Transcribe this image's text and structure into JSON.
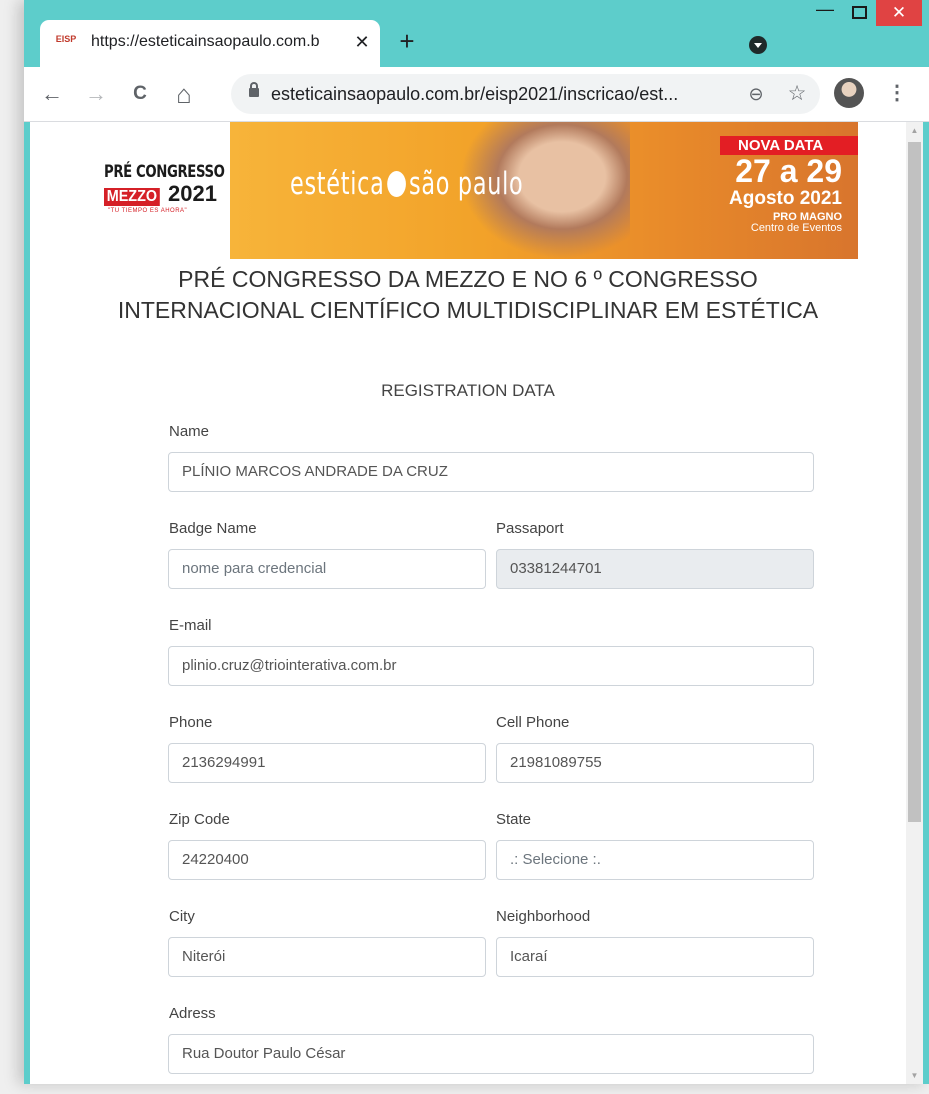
{
  "browser": {
    "tab_title": "https://esteticainsaopaulo.com.b",
    "tab_close": "✕",
    "new_tab": "+",
    "url": "esteticainsaopaulo.com.br/eisp2021/inscricao/est...",
    "win_min": "—",
    "win_close": "✕",
    "nav_back": "←",
    "nav_forward": "→",
    "nav_reload": "C",
    "nav_home": "⌂",
    "zoom_symbol": "⊖",
    "star_symbol": "☆",
    "menu_symbol": "⋮",
    "favicon_text": "EISP"
  },
  "banner": {
    "pre_congresso": "PRÉ CONGRESSO",
    "mezzo": "MEZZO",
    "year": "2021",
    "tagline": "\"TU TIEMPO ES AHORA\"",
    "brand_left": "estética",
    "brand_right": "são paulo",
    "nova_data": "NOVA DATA",
    "dates": "27 a 29",
    "month": "Agosto 2021",
    "venue": "PRO MAGNO",
    "venue_sub": "Centro de Eventos"
  },
  "page": {
    "title": "PRÉ CONGRESSO DA MEZZO E NO 6 º CONGRESSO INTERNACIONAL CIENTÍFICO MULTIDISCIPLINAR EM ESTÉTICA",
    "section": "REGISTRATION DATA"
  },
  "form": {
    "name": {
      "label": "Name",
      "value": "PLÍNIO MARCOS ANDRADE DA CRUZ"
    },
    "badge_name": {
      "label": "Badge Name",
      "placeholder": "nome para credencial"
    },
    "passport": {
      "label": "Passaport",
      "value": "03381244701"
    },
    "email": {
      "label": "E-mail",
      "value": "plinio.cruz@triointerativa.com.br"
    },
    "phone": {
      "label": "Phone",
      "value": "2136294991"
    },
    "cell_phone": {
      "label": "Cell Phone",
      "value": "21981089755"
    },
    "zip_code": {
      "label": "Zip Code",
      "value": "24220400"
    },
    "state": {
      "label": "State",
      "value": ".: Selecione :."
    },
    "city": {
      "label": "City",
      "value": "Niterói"
    },
    "neighborhood": {
      "label": "Neighborhood",
      "value": "Icaraí"
    },
    "address": {
      "label": "Adress",
      "value": "Rua Doutor Paulo César"
    }
  }
}
